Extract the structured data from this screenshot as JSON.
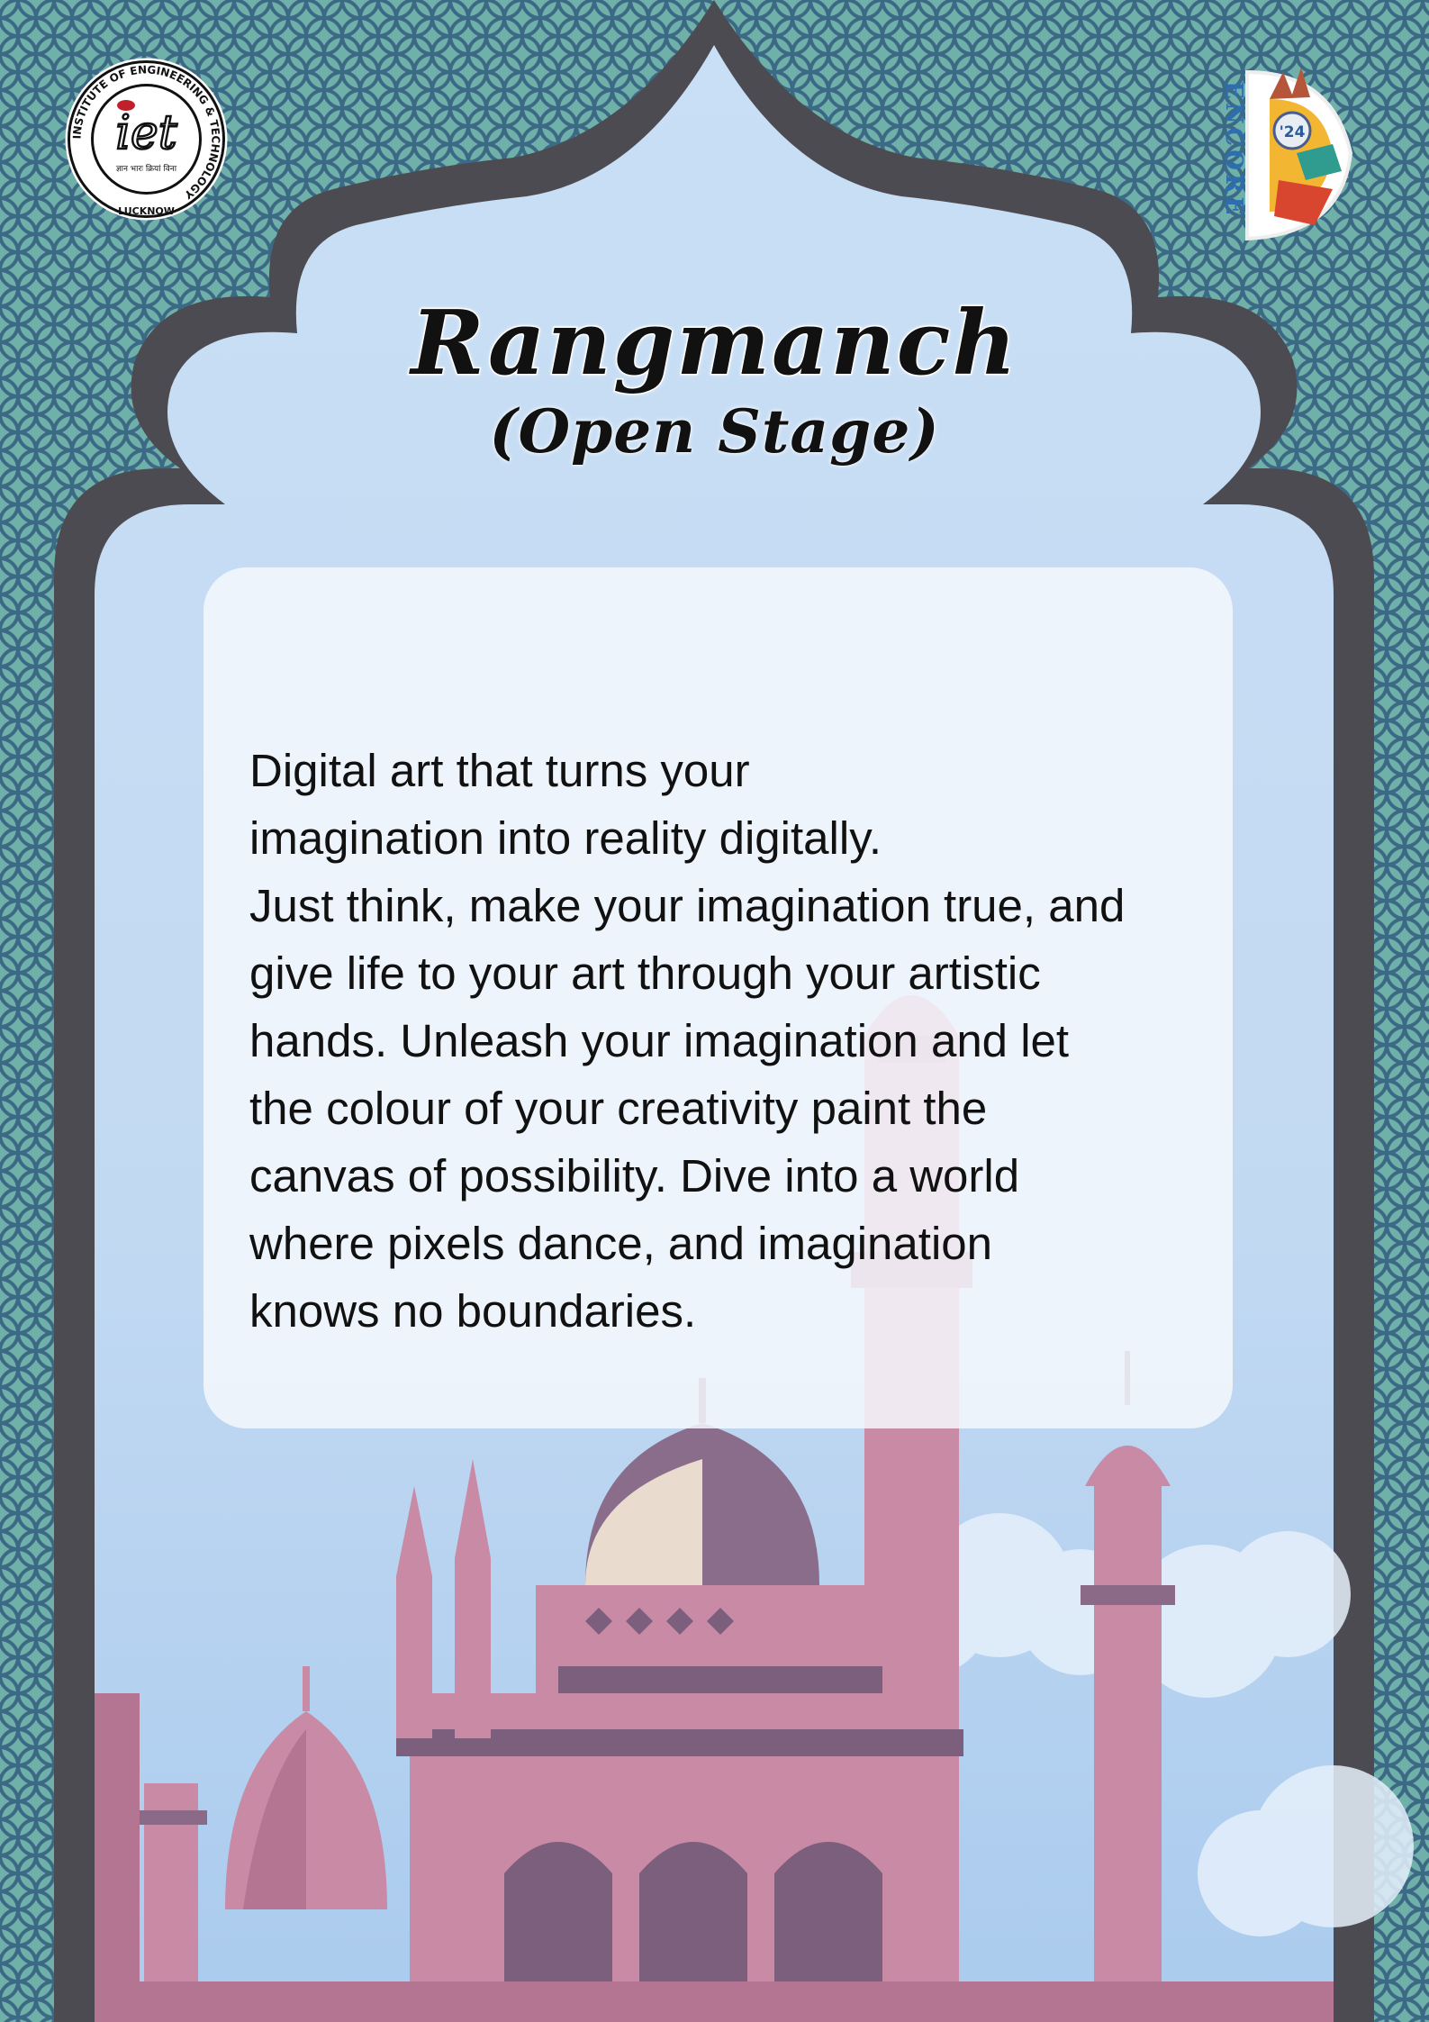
{
  "poster": {
    "title": "Rangmanch",
    "subtitle": "(Open Stage)",
    "description": "Digital art that turns your\n imagination into reality digitally.\nJust think, make your imagination true, and\ngive life to your art through your artistic\nhands. Unleash your imagination and let\nthe colour of your creativity paint the\ncanvas of possibility. Dive into a world\nwhere pixels dance, and imagination\nknows no boundaries."
  },
  "logos": {
    "iet": {
      "ring_text": "INSTITUTE OF ENGINEERING & TECHNOLOGY",
      "bottom_text": "LUCKNOW",
      "center_text": "iet",
      "hindi_text": "ज्ञान भारः क्रियां विना"
    },
    "encore": {
      "vertical_text": "ENCORE",
      "year": "'24"
    }
  },
  "colors": {
    "pattern_bg": "#6aa6a2",
    "pattern_line": "#3f6f86",
    "frame": "#4d4b52",
    "sky": "#c8def5",
    "building": "#c98aa6",
    "building_dark": "#7b5f7c"
  }
}
